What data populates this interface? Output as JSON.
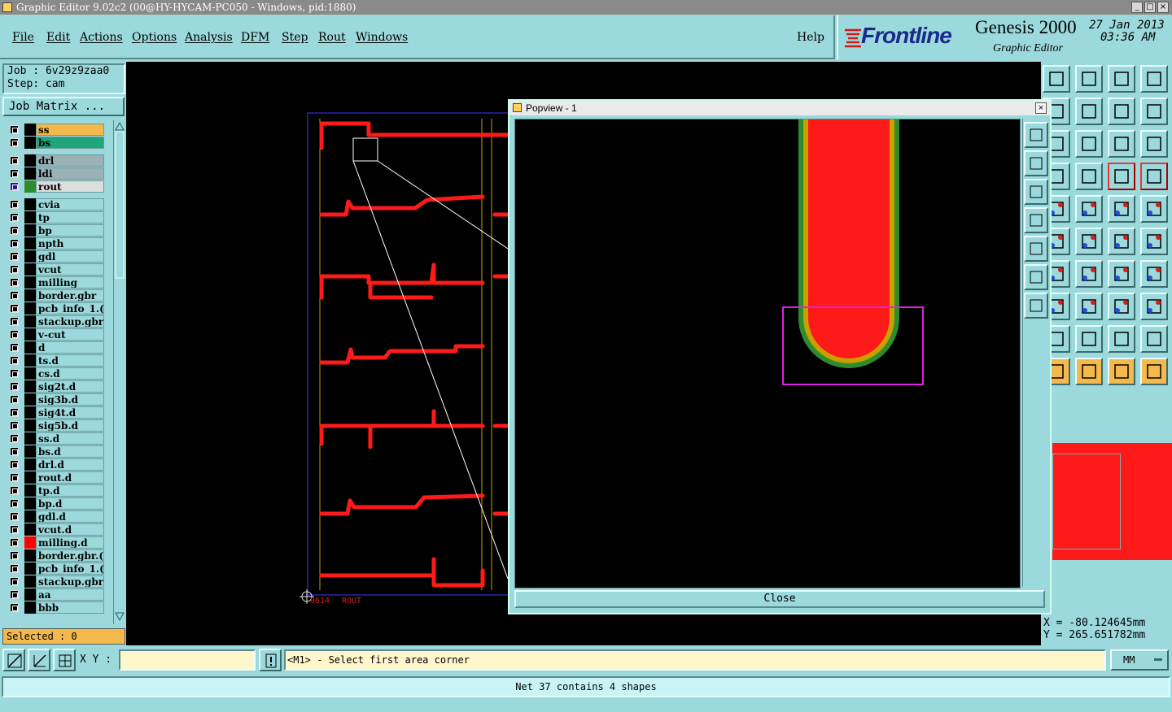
{
  "window": {
    "title": "Graphic Editor 9.02c2 (00@HY-HYCAM-PC050 - Windows, pid:1880)"
  },
  "menu": [
    "File",
    "Edit",
    "Actions",
    "Options",
    "Analysis",
    "DFM",
    "Step",
    "Rout",
    "Windows"
  ],
  "help_label": "Help",
  "brand": {
    "logo": "Frontline",
    "product": "Genesis 2000",
    "subtitle": "Graphic Editor",
    "date": "27 Jan 2013",
    "time": "03:36 AM"
  },
  "job": {
    "job_label": "Job : 6v29z9zaa0",
    "step_label": "Step: cam",
    "matrix_button": "Job Matrix ..."
  },
  "layers": [
    {
      "name": "ss",
      "color": "#f4b94c"
    },
    {
      "name": "bs",
      "color": "#1ea57a"
    },
    {
      "name": "drl",
      "color": "#9cb0b8"
    },
    {
      "name": "ldi",
      "color": "#9cb0b8"
    },
    {
      "name": "rout",
      "color": "#dddddd",
      "swatch": "#2e8b2e",
      "active": true
    },
    {
      "name": "cvia"
    },
    {
      "name": "tp"
    },
    {
      "name": "bp"
    },
    {
      "name": "npth"
    },
    {
      "name": "gdl"
    },
    {
      "name": "vcut"
    },
    {
      "name": "milling"
    },
    {
      "name": "border.gbr"
    },
    {
      "name": "pcb_info_1.("
    },
    {
      "name": "stackup.gbr"
    },
    {
      "name": "v-cut"
    },
    {
      "name": "d"
    },
    {
      "name": "ts.d"
    },
    {
      "name": "cs.d"
    },
    {
      "name": "sig2t.d"
    },
    {
      "name": "sig3b.d"
    },
    {
      "name": "sig4t.d"
    },
    {
      "name": "sig5b.d"
    },
    {
      "name": "ss.d"
    },
    {
      "name": "bs.d"
    },
    {
      "name": "drl.d"
    },
    {
      "name": "rout.d"
    },
    {
      "name": "tp.d"
    },
    {
      "name": "bp.d"
    },
    {
      "name": "gdl.d"
    },
    {
      "name": "vcut.d"
    },
    {
      "name": "milling.d",
      "swatch": "#ff0000"
    },
    {
      "name": "border.gbr.("
    },
    {
      "name": "pcb_info_1.("
    },
    {
      "name": "stackup.gbr"
    },
    {
      "name": "aa"
    },
    {
      "name": "bbb"
    }
  ],
  "selected_label": "Selected : 0",
  "canvas": {
    "origin_label": "0614",
    "layer_label": "ROUT"
  },
  "popview": {
    "title": "Popview - 1",
    "close_label": "Close"
  },
  "coords": {
    "x_label": "X = -80.124645mm",
    "y_label": "Y = 265.651782mm"
  },
  "command": {
    "xy_label": "X Y :",
    "xy_value": "",
    "prompt": "<M1> - Select first area corner",
    "units": "MM"
  },
  "status_text": "Net 37 contains 4 shapes",
  "colors": {
    "panel": "#9cd9dc",
    "trace": "#ff1a1a",
    "highlight": "#f4b94c"
  }
}
